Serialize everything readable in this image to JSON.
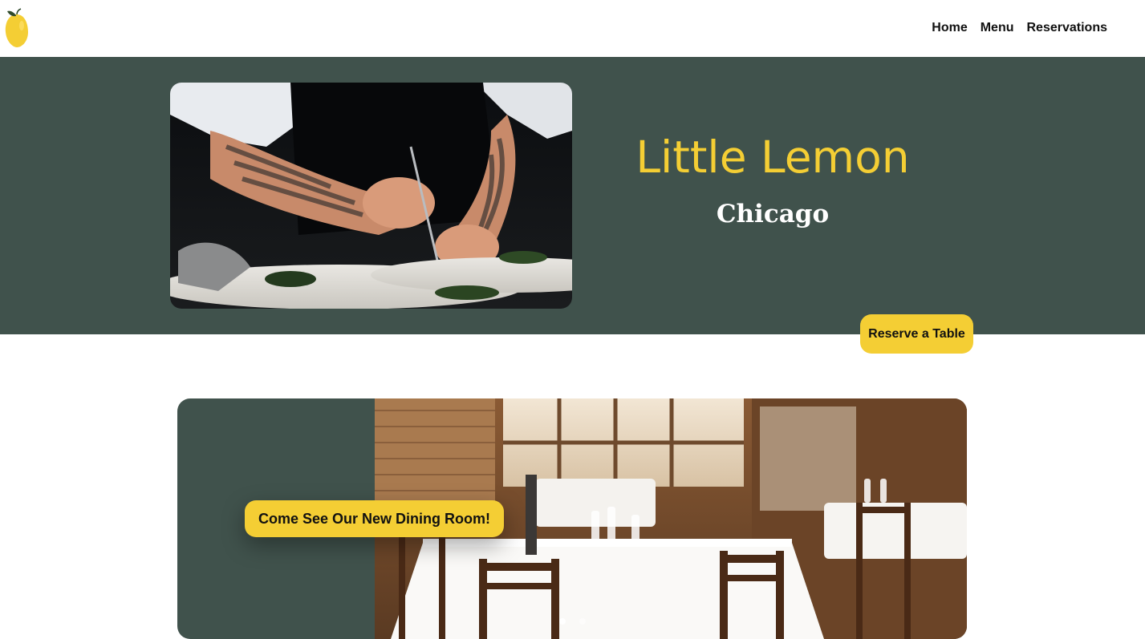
{
  "header": {
    "nav": [
      {
        "label": "Home"
      },
      {
        "label": "Menu"
      },
      {
        "label": "Reservations"
      }
    ]
  },
  "hero": {
    "title": "Little Lemon",
    "subtitle": "Chicago",
    "reserve_button": "Reserve a Table"
  },
  "dining": {
    "button_label": "Come See Our New Dining Room!",
    "carousel_slide_count": 2,
    "carousel_active_index": 0
  },
  "colors": {
    "brand_yellow": "#f4ce34",
    "brand_green": "#40524c",
    "text_dark": "#111111"
  },
  "icons": {
    "logo": "lemon-icon"
  }
}
